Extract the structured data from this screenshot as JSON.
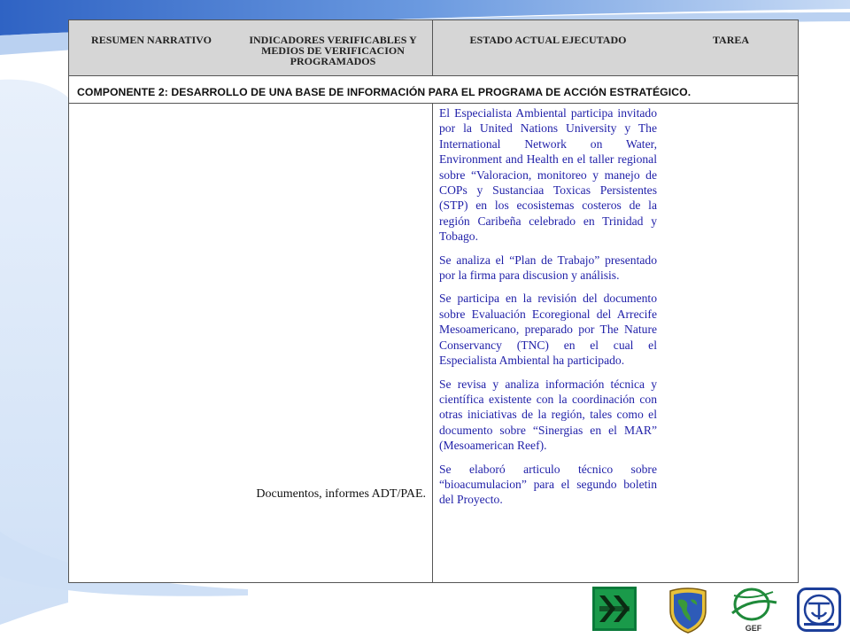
{
  "table": {
    "headers": [
      "RESUMEN NARRATIVO",
      "INDICADORES VERIFICABLES Y MEDIOS DE VERIFICACION PROGRAMADOS",
      "ESTADO ACTUAL EJECUTADO",
      "TAREA"
    ],
    "component_title": "COMPONENTE 2: DESARROLLO DE UNA BASE DE INFORMACIÓN PARA EL PROGRAMA DE ACCIÓN ESTRATÉGICO.",
    "indicator": "Documentos, informes ADT/PAE.",
    "status_paragraphs": [
      "El Especialista Ambiental participa invitado por la United Nations University y The International Network on Water, Environment and Health en el taller regional sobre “Valoracion, monitoreo y manejo de COPs y Sustanciaa Toxicas Persistentes (STP) en los ecosistemas costeros de la región Caribeña celebrado en Trinidad y Tobago.",
      "Se analiza el “Plan de Trabajo” presentado por la firma para discusion y análisis.",
      "Se participa en la revisión del documento sobre Evaluación Ecoregional del Arrecife Mesoamericano, preparado por The Nature Conservancy (TNC) en el cual el Especialista Ambiental ha participado.",
      "Se revisa y analiza información técnica y científica existente con la coordinación con otras iniciativas de la región, tales como el documento sobre “Sinergias en el MAR” (Mesoamerican Reef).",
      "Se elaboró articulo técnico sobre “bioacumulacion” para el segundo boletin del Proyecto."
    ]
  },
  "logos": {
    "gef_label": "GEF"
  },
  "colors": {
    "header_bg": "#d6d6d6",
    "status_text": "#1f1fa8",
    "swoosh": "#4a7fd0"
  }
}
